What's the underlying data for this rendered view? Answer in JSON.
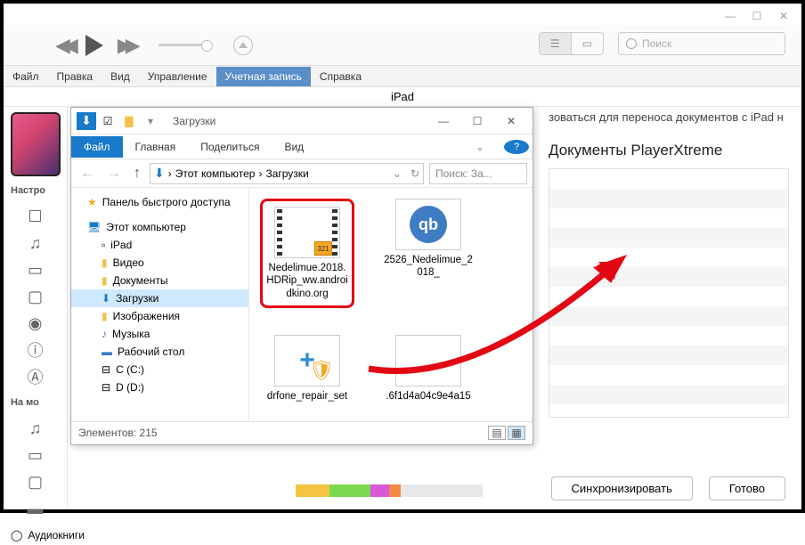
{
  "itunes": {
    "search_placeholder": "Поиск",
    "menu": [
      "Файл",
      "Правка",
      "Вид",
      "Управление",
      "Учетная запись",
      "Справка"
    ],
    "device": "iPad",
    "sidebar": {
      "settings": "Настро",
      "my": "На мо",
      "audiobooks": "Аудиокниги"
    },
    "hint": "зоваться для переноса документов с iPad н",
    "docs_title": "Документы PlayerXtreme",
    "sync": "Синхронизировать",
    "done": "Готово"
  },
  "explorer": {
    "title": "Загрузки",
    "tabs": {
      "file": "Файл",
      "home": "Главная",
      "share": "Поделиться",
      "view": "Вид"
    },
    "breadcrumb": {
      "pc": "Этот компьютер",
      "dl": "Загрузки"
    },
    "search_placeholder": "Поиск: За...",
    "tree": {
      "quick": "Панель быстрого доступа",
      "pc": "Этот компьютер",
      "ipad": "iPad",
      "video": "Видео",
      "docs": "Документы",
      "downloads": "Загрузки",
      "images": "Изображения",
      "music": "Музыка",
      "desktop": "Рабочий стол",
      "c": "C (C:)",
      "d": "D (D:)"
    },
    "files": {
      "f1": "Nedelimue.2018.HDRip_ww.androidkino.org",
      "f2": "2526_Nedelimue_2018_",
      "f3": "drfone_repair_set",
      "f4": ".6f1d4a04c9e4a15"
    },
    "status": "Элементов: 215"
  }
}
